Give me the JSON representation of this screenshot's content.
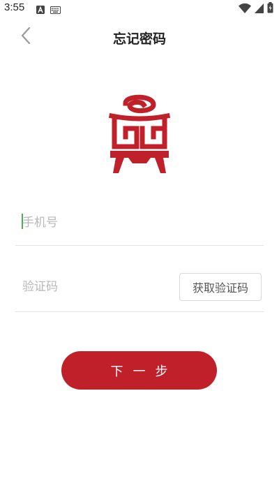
{
  "status_bar": {
    "time": "3:55",
    "icons": [
      "a-notification-icon",
      "keyboard-icon",
      "wifi-icon",
      "signal-icon",
      "battery-charging-icon"
    ]
  },
  "nav": {
    "title": "忘记密码",
    "back_icon": "chevron-left-icon"
  },
  "logo": {
    "icon": "app-logo",
    "color": "#c0202a"
  },
  "form": {
    "phone_placeholder": "手机号",
    "phone_value": "",
    "code_placeholder": "验证码",
    "code_value": "",
    "get_code_label": "获取验证码"
  },
  "next_button": {
    "label": "下一步"
  },
  "colors": {
    "accent": "#c0202a",
    "divider": "#e3e3e3",
    "placeholder": "#b8b8b8",
    "cursor": "#4caf50"
  }
}
